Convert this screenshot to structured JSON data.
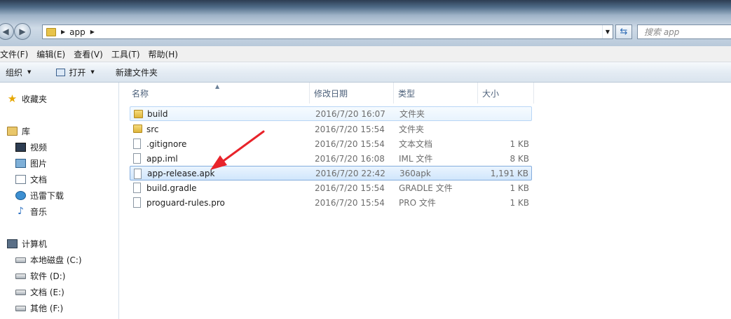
{
  "address": {
    "segments": [
      "app"
    ],
    "search_placeholder": "搜索 app"
  },
  "menu": [
    "文件(F)",
    "编辑(E)",
    "查看(V)",
    "工具(T)",
    "帮助(H)"
  ],
  "commands": {
    "organize": "组织",
    "open": "打开",
    "new_folder": "新建文件夹"
  },
  "nav": {
    "favorites": "收藏夹",
    "libraries": "库",
    "library_items": [
      "视频",
      "图片",
      "文档",
      "迅雷下载",
      "音乐"
    ],
    "computer": "计算机",
    "drives": [
      "本地磁盘 (C:)",
      "软件 (D:)",
      "文档 (E:)",
      "其他 (F:)"
    ]
  },
  "columns": {
    "name": "名称",
    "date": "修改日期",
    "type": "类型",
    "size": "大小"
  },
  "files": [
    {
      "name": "build",
      "date": "2016/7/20 16:07",
      "type": "文件夹",
      "size": "",
      "icon": "folder-icon",
      "state": "hover"
    },
    {
      "name": "src",
      "date": "2016/7/20 15:54",
      "type": "文件夹",
      "size": "",
      "icon": "folder-icon",
      "state": ""
    },
    {
      "name": ".gitignore",
      "date": "2016/7/20 15:54",
      "type": "文本文档",
      "size": "1 KB",
      "icon": "file-icon",
      "state": ""
    },
    {
      "name": "app.iml",
      "date": "2016/7/20 16:08",
      "type": "IML 文件",
      "size": "8 KB",
      "icon": "file-icon",
      "state": ""
    },
    {
      "name": "app-release.apk",
      "date": "2016/7/20 22:42",
      "type": "360apk",
      "size": "1,191 KB",
      "icon": "file-icon",
      "state": "selected"
    },
    {
      "name": "build.gradle",
      "date": "2016/7/20 15:54",
      "type": "GRADLE 文件",
      "size": "1 KB",
      "icon": "file-icon",
      "state": ""
    },
    {
      "name": "proguard-rules.pro",
      "date": "2016/7/20 15:54",
      "type": "PRO 文件",
      "size": "1 KB",
      "icon": "file-icon",
      "state": ""
    }
  ],
  "colors": {
    "annotation_arrow": "#e8232a",
    "selection_border": "#84acdd"
  }
}
